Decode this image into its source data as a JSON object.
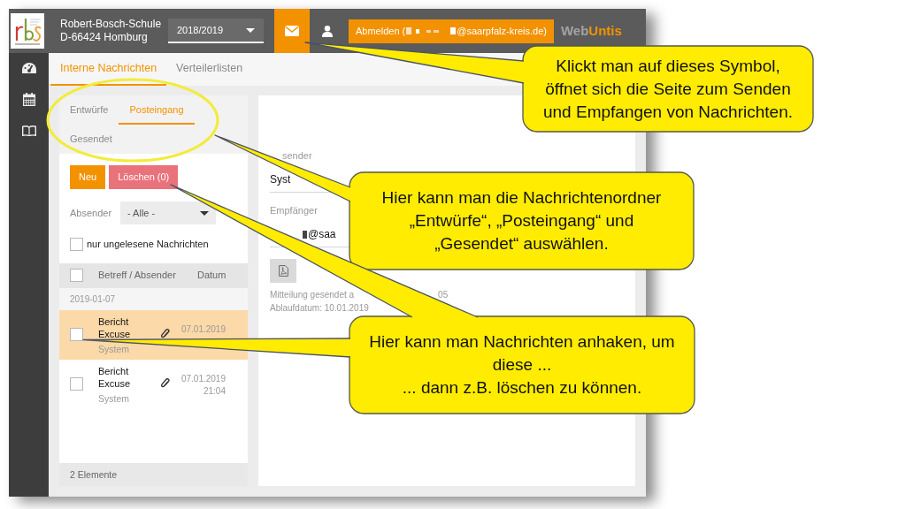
{
  "header": {
    "school_name": "Robert-Bosch-Schule",
    "school_address": "D-66424 Homburg",
    "school_year": "2018/2019",
    "nav_icons": [
      {
        "kind": "mail",
        "selected": true
      },
      {
        "kind": "user",
        "selected": false
      }
    ],
    "logout": {
      "label_start": "Abmelden (",
      "label_end": "@saarpfalz-kreis.de)"
    },
    "brand": {
      "part_1": "Web",
      "part_2": "Untis"
    }
  },
  "sidebar": {
    "items": [
      {
        "kind": "dashboard"
      },
      {
        "kind": "calendar"
      },
      {
        "kind": "book"
      }
    ]
  },
  "tabs": [
    {
      "label": "Interne Nachrichten",
      "selected": true
    },
    {
      "label": "Verteilerlisten",
      "selected": false
    }
  ],
  "folders": [
    {
      "label": "Entwürfe",
      "selected": false
    },
    {
      "label": "Posteingang",
      "selected": true
    },
    {
      "label": "Gesendet",
      "selected": false
    }
  ],
  "actions": [
    {
      "label": "Neu",
      "kind": "primary"
    },
    {
      "label": "Löschen (0)",
      "kind": "danger"
    }
  ],
  "filter": {
    "label": "Absender",
    "value": "- Alle -"
  },
  "unread_only": {
    "label": "nur ungelesene Nachrichten",
    "checked": false
  },
  "table": {
    "select_all_checked": false,
    "columns": [
      "Betreff / Absender",
      "Datum"
    ],
    "group_label": "2019-01-07",
    "rows": [
      {
        "subject": "Bericht Excuse",
        "sender": "System",
        "attachment": true,
        "date": "07.01.2019",
        "checked": false,
        "selected": true
      },
      {
        "subject": "Bericht Excuse",
        "sender": "System",
        "attachment": true,
        "date": "07.01.2019",
        "time": "21:04",
        "checked": false,
        "selected": false
      }
    ],
    "footer": "2 Elemente"
  },
  "detail": {
    "fields": [
      {
        "label": "sender",
        "value": "Syst",
        "redacted": false
      },
      {
        "label": "Empfänger",
        "value": "@saa",
        "redacted": true
      }
    ],
    "attachment": {
      "kind": "pdf"
    },
    "sent_note": "Mitteilung gesendet a",
    "sent_note_tail": "05",
    "expiry": "Ablaufdatum: 10.01.2019"
  },
  "callouts": [
    {
      "text": "Klickt man auf dieses Symbol,\nöffnet sich die Seite zum Senden\nund Empfangen von Nachrichten."
    },
    {
      "text": "Hier kann man die Nachrichtenordner\n„Entwürfe“, „Posteingang“ und\n„Gesendet“ auswählen."
    },
    {
      "text": "Hier kann man Nachrichten anhaken, um\ndiese ...\n... dann z.B. löschen zu können."
    }
  ]
}
